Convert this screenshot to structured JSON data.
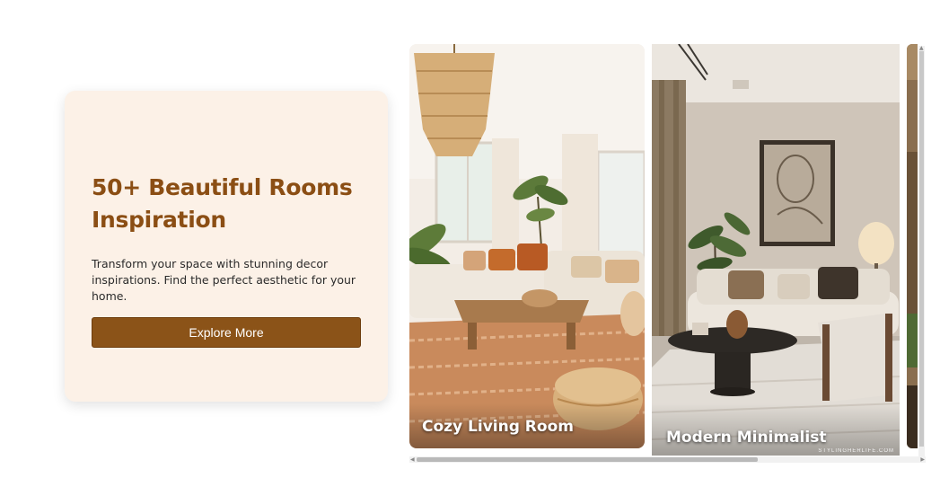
{
  "hero": {
    "title": "50+ Beautiful Rooms Inspiration",
    "description": "Transform your space with stunning decor inspirations. Find the perfect aesthetic for your home.",
    "button_label": "Explore More"
  },
  "rooms": [
    {
      "label": "Cozy Living Room",
      "image": "boho-living-room-photo"
    },
    {
      "label": "Modern Minimalist",
      "image": "neutral-minimalist-living-room-photo",
      "watermark": "STYLINGHERLIFE.COM"
    },
    {
      "label": "",
      "image": "partially-visible-room-photo"
    }
  ],
  "colors": {
    "accent": "#8b5318",
    "title": "#8b4e14",
    "card_bg": "#fcf1e7"
  },
  "icons": [
    "scroll-left-arrow-icon",
    "scroll-right-arrow-icon",
    "scroll-up-arrow-icon",
    "scroll-down-arrow-icon"
  ]
}
